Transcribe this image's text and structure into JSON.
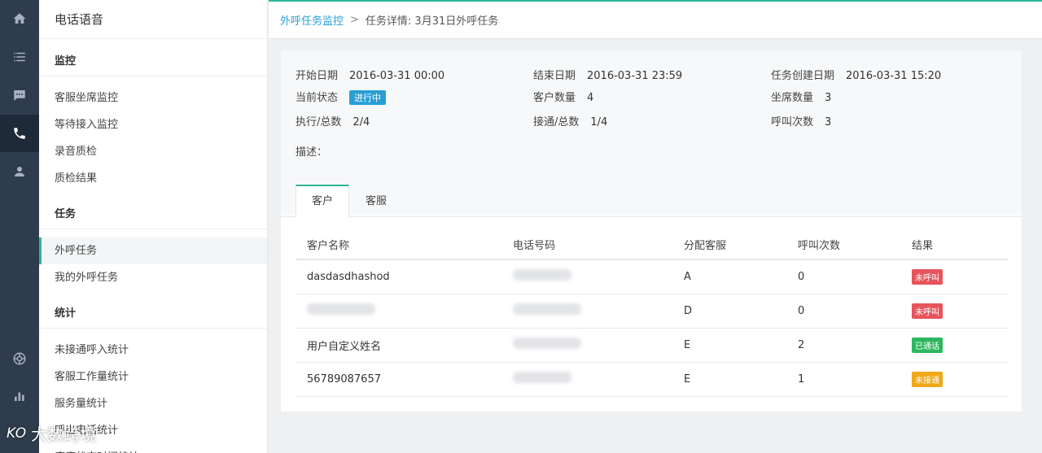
{
  "rail": {
    "items": [
      {
        "icon": "home-icon",
        "active": false
      },
      {
        "icon": "list-icon",
        "active": false
      },
      {
        "icon": "chat-icon",
        "active": false
      },
      {
        "icon": "phone-icon",
        "active": true
      },
      {
        "icon": "user-icon",
        "active": false
      },
      {
        "icon": "globe-icon",
        "active": false
      },
      {
        "icon": "bar-chart-icon",
        "active": false
      }
    ]
  },
  "sidebar": {
    "title": "电话语音",
    "groups": [
      {
        "label": "监控",
        "items": [
          "客服坐席监控",
          "等待接入监控",
          "录音质检",
          "质检结果"
        ]
      },
      {
        "label": "任务",
        "items": [
          "外呼任务",
          "我的外呼任务"
        ]
      },
      {
        "label": "统计",
        "items": [
          "未接通呼入统计",
          "客服工作量统计",
          "服务量统计",
          "呼出电话统计",
          "座席状态时间统计"
        ]
      }
    ],
    "active_item": "外呼任务"
  },
  "breadcrumb": {
    "link": "外呼任务监控",
    "separator": ">",
    "current": "任务详情: 3月31日外呼任务"
  },
  "details": {
    "start_label": "开始日期",
    "start_value": "2016-03-31 00:00",
    "end_label": "结束日期",
    "end_value": "2016-03-31 23:59",
    "created_label": "任务创建日期",
    "created_value": "2016-03-31 15:20",
    "status_label": "当前状态",
    "status_value": "进行中",
    "customers_label": "客户数量",
    "customers_value": "4",
    "agents_label": "坐席数量",
    "agents_value": "3",
    "executed_label": "执行/总数",
    "executed_value": "2/4",
    "connected_label": "接通/总数",
    "connected_value": "1/4",
    "calls_label": "呼叫次数",
    "calls_value": "3",
    "desc_label": "描述："
  },
  "tabs": [
    "客户",
    "客服"
  ],
  "table": {
    "headers": [
      "客户名称",
      "电话号码",
      "分配客服",
      "呼叫次数",
      "结果"
    ],
    "rows": [
      {
        "name": "dasdasdhashod",
        "agent": "A",
        "calls": "0",
        "result": "未呼叫",
        "result_color": "#e8545c"
      },
      {
        "name": "",
        "agent": "D",
        "calls": "0",
        "result": "未呼叫",
        "result_color": "#e8545c"
      },
      {
        "name": "用户自定义姓名",
        "agent": "E",
        "calls": "2",
        "result": "已通话",
        "result_color": "#2db760"
      },
      {
        "name": "56789087657",
        "agent": "E",
        "calls": "1",
        "result": "未接通",
        "result_color": "#f0a818"
      }
    ]
  },
  "colors": {
    "accent": "#2eb49a",
    "link": "#2a9fd6",
    "rail_bg": "#2f3c4e"
  },
  "watermark": {
    "logo": "KO",
    "text": "大数跨境"
  }
}
